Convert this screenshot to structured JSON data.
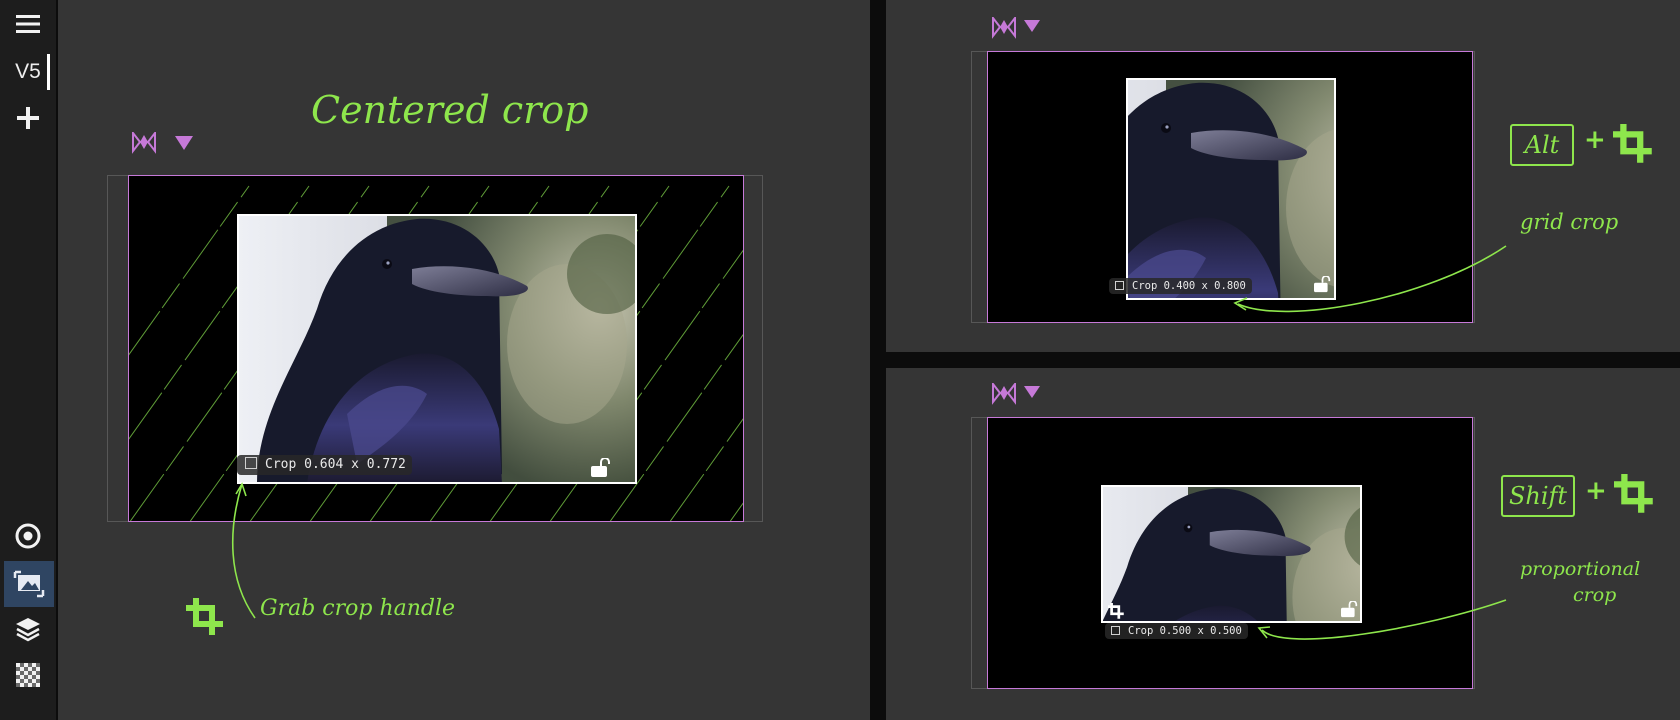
{
  "sidebar": {
    "version": "V5",
    "icons": [
      "menu-icon",
      "add-icon",
      "target-icon",
      "crop-image-icon",
      "layers-icon",
      "checkerboard-icon"
    ]
  },
  "main": {
    "title": "Centered crop",
    "crop_label": "Crop 0.604 x 0.772",
    "annotation": "Grab crop handle"
  },
  "top_right": {
    "crop_label": "Crop 0.400 x 0.800",
    "key": "Alt",
    "plus": "+",
    "annotation": "grid crop"
  },
  "bottom_right": {
    "crop_label": "Crop 0.500 x 0.500",
    "key": "Shift",
    "plus": "+",
    "annotation_line1": "proportional",
    "annotation_line2": "crop"
  },
  "colors": {
    "accent_green": "#8ee64c",
    "frame_pink": "#c679d8",
    "panel_bg": "#353535",
    "sidebar_bg": "#1d1d1d",
    "active_tool_bg": "#2f4562"
  }
}
